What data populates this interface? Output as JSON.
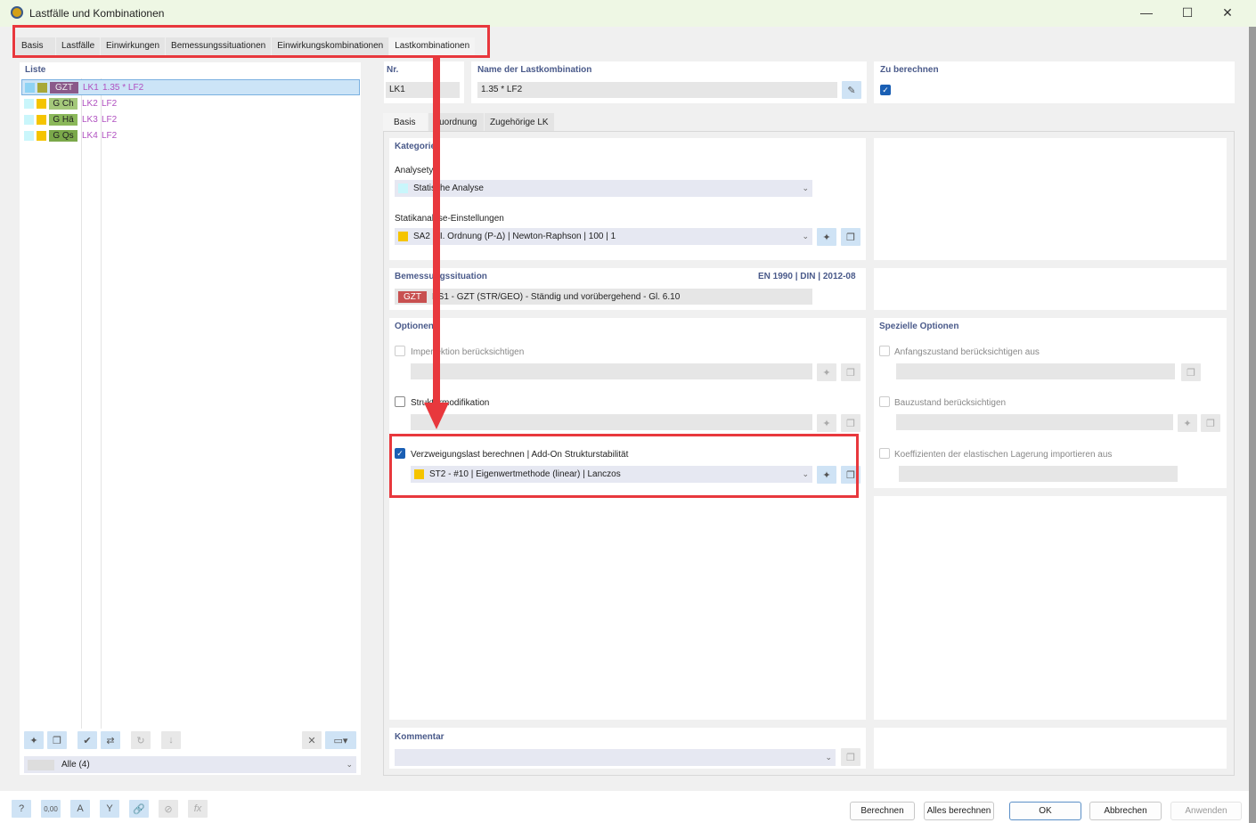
{
  "window": {
    "title": "Lastfälle und Kombinationen",
    "minimize": "—",
    "maximize": "☐",
    "close": "✕"
  },
  "tabs": [
    "Basis",
    "Lastfälle",
    "Einwirkungen",
    "Bemessungssituationen",
    "Einwirkungskombinationen",
    "Lastkombinationen"
  ],
  "active_tab": "Lastkombinationen",
  "list": {
    "heading": "Liste",
    "rows": [
      {
        "c1": "#8fd3f4",
        "c2": "#a8a838",
        "badge": "GZT",
        "badge_color": "#8a5a8a",
        "nr": "LK1",
        "name": "1.35 * LF2",
        "selected": true
      },
      {
        "c1": "#c9f6fb",
        "c2": "#f5c400",
        "badge": "G Ch",
        "badge_color": "#a4c87a",
        "nr": "LK2",
        "name": "LF2"
      },
      {
        "c1": "#c9f6fb",
        "c2": "#f5c400",
        "badge": "G Hä",
        "badge_color": "#8bb85a",
        "nr": "LK3",
        "name": "LF2"
      },
      {
        "c1": "#c9f6fb",
        "c2": "#f5c400",
        "badge": "G Qs",
        "badge_color": "#7aa84a",
        "nr": "LK4",
        "name": "LF2"
      }
    ],
    "filter": "Alle (4)"
  },
  "nr": {
    "label": "Nr.",
    "value": "LK1"
  },
  "name": {
    "label": "Name der Lastkombination",
    "value": "1.35 * LF2"
  },
  "calc": {
    "label": "Zu berechnen",
    "checked": true
  },
  "subtabs": [
    "Basis",
    "Zuordnung",
    "Zugehörige LK"
  ],
  "kategorie": {
    "heading": "Kategorie",
    "analysis_label": "Analysetyp",
    "analysis_value": "Statische Analyse",
    "settings_label": "Statikanalyse-Einstellungen",
    "settings_value": "SA2 | II. Ordnung (P-Δ) | Newton-Raphson | 100 | 1"
  },
  "bemessung": {
    "heading": "Bemessungssituation",
    "norm": "EN 1990 | DIN | 2012-08",
    "badge": "GZT",
    "value": "BS1 - GZT (STR/GEO) - Ständig und vorübergehend - Gl. 6.10"
  },
  "optionen": {
    "heading": "Optionen",
    "imperfection": "Imperfektion berücksichtigen",
    "structure": "Strukturmodifikation",
    "buckling": "Verzweigungslast berechnen | Add-On Strukturstabilität",
    "buckling_checked": true,
    "buckling_value": "ST2 - #10 | Eigenwertmethode (linear) | Lanczos"
  },
  "spezielle": {
    "heading": "Spezielle Optionen",
    "initial": "Anfangszustand berücksichtigen aus",
    "construction": "Bauzustand berücksichtigen",
    "coefficients": "Koeffizienten der elastischen Lagerung importieren aus"
  },
  "kommentar": {
    "heading": "Kommentar",
    "value": ""
  },
  "buttons": {
    "calc": "Berechnen",
    "calc_all": "Alles berechnen",
    "ok": "OK",
    "cancel": "Abbrechen",
    "apply": "Anwenden"
  },
  "colors": {
    "accent": "#e8383d",
    "heading": "#4a5a8a",
    "selection": "#cce4f7"
  }
}
